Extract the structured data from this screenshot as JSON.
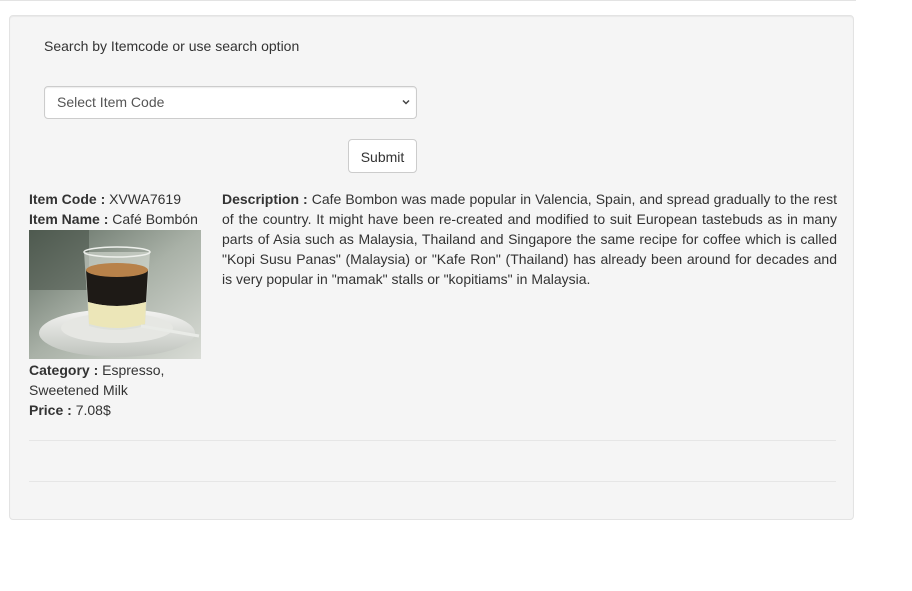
{
  "search": {
    "label": "Search by Itemcode or use search option",
    "select_value": "Select Item Code",
    "submit_label": "Submit"
  },
  "item": {
    "code_label": "Item Code :",
    "code": "XVWA7619",
    "name_label": "Item Name :",
    "name": "Café Bombón",
    "category_label": "Category :",
    "category": "Espresso, Sweetened Milk",
    "price_label": "Price :",
    "price": "7.08$",
    "description_label": "Description :",
    "description": "Cafe Bombon was made popular in Valencia, Spain, and spread gradually to the rest of the country. It might have been re-created and modified to suit European tastebuds as in many parts of Asia such as Malaysia, Thailand and Singapore the same recipe for coffee which is called \"Kopi Susu Panas\" (Malaysia) or \"Kafe Ron\" (Thailand) has already been around for decades and is very popular in \"mamak\" stalls or \"kopitiams\" in Malaysia."
  }
}
